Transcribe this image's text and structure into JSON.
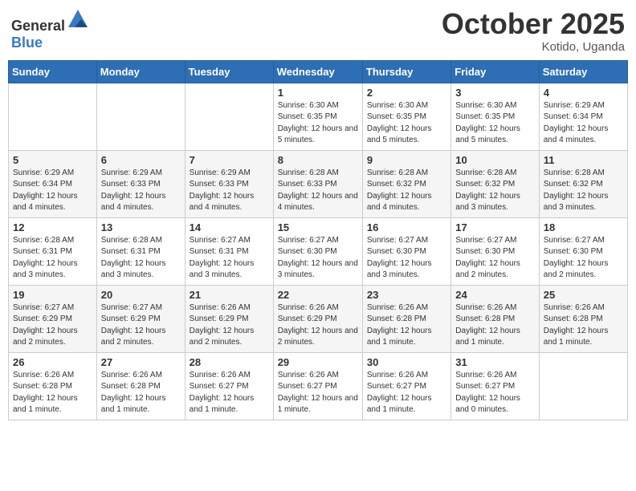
{
  "header": {
    "logo_general": "General",
    "logo_blue": "Blue",
    "month_title": "October 2025",
    "location": "Kotido, Uganda"
  },
  "weekdays": [
    "Sunday",
    "Monday",
    "Tuesday",
    "Wednesday",
    "Thursday",
    "Friday",
    "Saturday"
  ],
  "weeks": [
    [
      {
        "day": "",
        "info": ""
      },
      {
        "day": "",
        "info": ""
      },
      {
        "day": "",
        "info": ""
      },
      {
        "day": "1",
        "info": "Sunrise: 6:30 AM\nSunset: 6:35 PM\nDaylight: 12 hours\nand 5 minutes."
      },
      {
        "day": "2",
        "info": "Sunrise: 6:30 AM\nSunset: 6:35 PM\nDaylight: 12 hours\nand 5 minutes."
      },
      {
        "day": "3",
        "info": "Sunrise: 6:30 AM\nSunset: 6:35 PM\nDaylight: 12 hours\nand 5 minutes."
      },
      {
        "day": "4",
        "info": "Sunrise: 6:29 AM\nSunset: 6:34 PM\nDaylight: 12 hours\nand 4 minutes."
      }
    ],
    [
      {
        "day": "5",
        "info": "Sunrise: 6:29 AM\nSunset: 6:34 PM\nDaylight: 12 hours\nand 4 minutes."
      },
      {
        "day": "6",
        "info": "Sunrise: 6:29 AM\nSunset: 6:33 PM\nDaylight: 12 hours\nand 4 minutes."
      },
      {
        "day": "7",
        "info": "Sunrise: 6:29 AM\nSunset: 6:33 PM\nDaylight: 12 hours\nand 4 minutes."
      },
      {
        "day": "8",
        "info": "Sunrise: 6:28 AM\nSunset: 6:33 PM\nDaylight: 12 hours\nand 4 minutes."
      },
      {
        "day": "9",
        "info": "Sunrise: 6:28 AM\nSunset: 6:32 PM\nDaylight: 12 hours\nand 4 minutes."
      },
      {
        "day": "10",
        "info": "Sunrise: 6:28 AM\nSunset: 6:32 PM\nDaylight: 12 hours\nand 3 minutes."
      },
      {
        "day": "11",
        "info": "Sunrise: 6:28 AM\nSunset: 6:32 PM\nDaylight: 12 hours\nand 3 minutes."
      }
    ],
    [
      {
        "day": "12",
        "info": "Sunrise: 6:28 AM\nSunset: 6:31 PM\nDaylight: 12 hours\nand 3 minutes."
      },
      {
        "day": "13",
        "info": "Sunrise: 6:28 AM\nSunset: 6:31 PM\nDaylight: 12 hours\nand 3 minutes."
      },
      {
        "day": "14",
        "info": "Sunrise: 6:27 AM\nSunset: 6:31 PM\nDaylight: 12 hours\nand 3 minutes."
      },
      {
        "day": "15",
        "info": "Sunrise: 6:27 AM\nSunset: 6:30 PM\nDaylight: 12 hours\nand 3 minutes."
      },
      {
        "day": "16",
        "info": "Sunrise: 6:27 AM\nSunset: 6:30 PM\nDaylight: 12 hours\nand 3 minutes."
      },
      {
        "day": "17",
        "info": "Sunrise: 6:27 AM\nSunset: 6:30 PM\nDaylight: 12 hours\nand 2 minutes."
      },
      {
        "day": "18",
        "info": "Sunrise: 6:27 AM\nSunset: 6:30 PM\nDaylight: 12 hours\nand 2 minutes."
      }
    ],
    [
      {
        "day": "19",
        "info": "Sunrise: 6:27 AM\nSunset: 6:29 PM\nDaylight: 12 hours\nand 2 minutes."
      },
      {
        "day": "20",
        "info": "Sunrise: 6:27 AM\nSunset: 6:29 PM\nDaylight: 12 hours\nand 2 minutes."
      },
      {
        "day": "21",
        "info": "Sunrise: 6:26 AM\nSunset: 6:29 PM\nDaylight: 12 hours\nand 2 minutes."
      },
      {
        "day": "22",
        "info": "Sunrise: 6:26 AM\nSunset: 6:29 PM\nDaylight: 12 hours\nand 2 minutes."
      },
      {
        "day": "23",
        "info": "Sunrise: 6:26 AM\nSunset: 6:28 PM\nDaylight: 12 hours\nand 1 minute."
      },
      {
        "day": "24",
        "info": "Sunrise: 6:26 AM\nSunset: 6:28 PM\nDaylight: 12 hours\nand 1 minute."
      },
      {
        "day": "25",
        "info": "Sunrise: 6:26 AM\nSunset: 6:28 PM\nDaylight: 12 hours\nand 1 minute."
      }
    ],
    [
      {
        "day": "26",
        "info": "Sunrise: 6:26 AM\nSunset: 6:28 PM\nDaylight: 12 hours\nand 1 minute."
      },
      {
        "day": "27",
        "info": "Sunrise: 6:26 AM\nSunset: 6:28 PM\nDaylight: 12 hours\nand 1 minute."
      },
      {
        "day": "28",
        "info": "Sunrise: 6:26 AM\nSunset: 6:27 PM\nDaylight: 12 hours\nand 1 minute."
      },
      {
        "day": "29",
        "info": "Sunrise: 6:26 AM\nSunset: 6:27 PM\nDaylight: 12 hours\nand 1 minute."
      },
      {
        "day": "30",
        "info": "Sunrise: 6:26 AM\nSunset: 6:27 PM\nDaylight: 12 hours\nand 1 minute."
      },
      {
        "day": "31",
        "info": "Sunrise: 6:26 AM\nSunset: 6:27 PM\nDaylight: 12 hours\nand 0 minutes."
      },
      {
        "day": "",
        "info": ""
      }
    ]
  ]
}
